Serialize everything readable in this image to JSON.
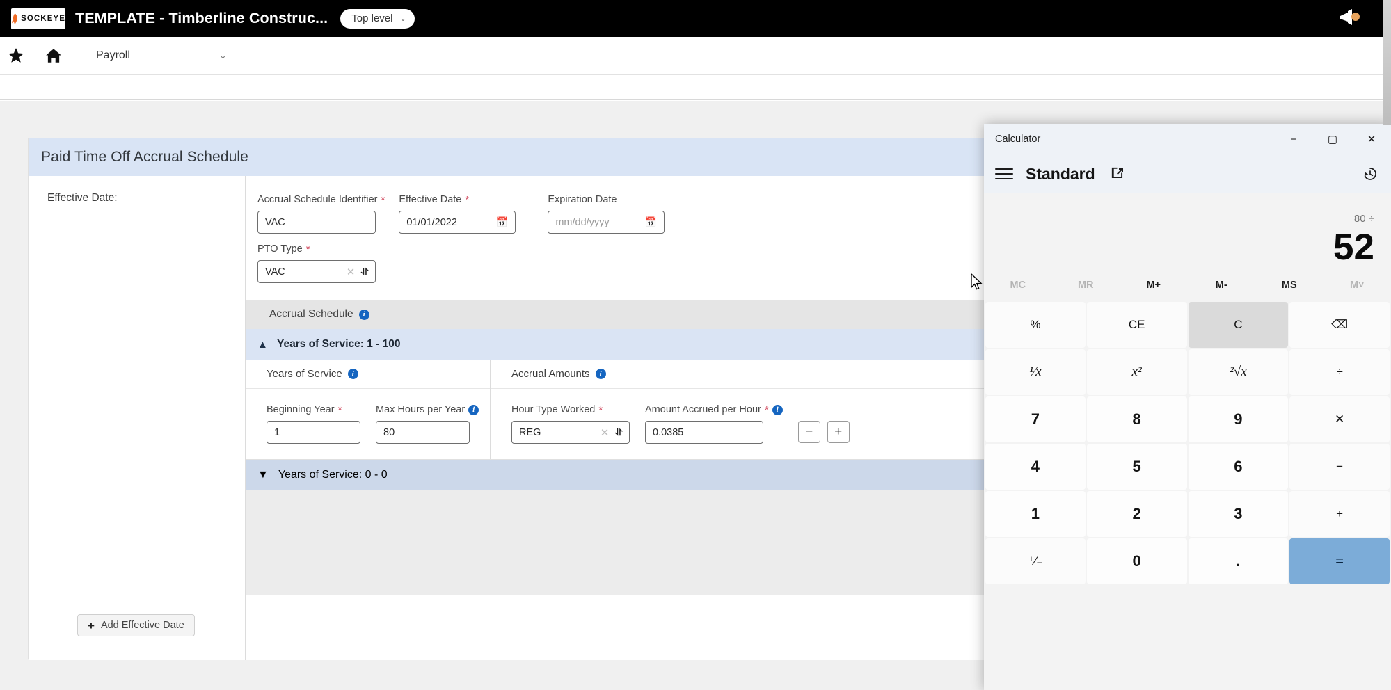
{
  "topbar": {
    "logo_text": "SOCKEYE",
    "app_title": "TEMPLATE - Timberline Construc...",
    "scope_label": "Top level",
    "scope_caret": "⌄",
    "megaphone_icon": "megaphone-icon"
  },
  "navbar": {
    "star_icon": "star-icon",
    "home_icon": "home-icon",
    "module_label": "Payroll",
    "module_caret": "⌄"
  },
  "card": {
    "title": "Paid Time Off Accrual Schedule",
    "left_pane": {
      "effective_date_label": "Effective Date:",
      "add_button_label": "Add Effective Date",
      "add_button_icon": "plus-icon"
    },
    "fields": {
      "accrual_schedule_identifier": {
        "label": "Accrual Schedule Identifier",
        "required": "*",
        "value": "VAC"
      },
      "effective_date": {
        "label": "Effective Date",
        "required": "*",
        "value": "01/01/2022",
        "icon": "calendar-icon"
      },
      "expiration_date": {
        "label": "Expiration Date",
        "required": "",
        "placeholder": "mm/dd/yyyy",
        "icon": "calendar-icon"
      },
      "pto_type": {
        "label": "PTO Type",
        "required": "*",
        "value": "VAC",
        "clear_icon": "clear-x-icon",
        "caret_icon": "chevron-down-icon"
      }
    },
    "accrual_schedule_band": {
      "label": "Accrual Schedule",
      "info_icon": "info-icon"
    },
    "section_1": {
      "collapse_icon": "chevron-up-icon",
      "title": "Years of Service: 1 - 100",
      "left_col_header": "Years of Service",
      "left_col_info": "info-icon",
      "right_col_header": "Accrual Amounts",
      "right_col_info": "info-icon",
      "beginning_year": {
        "label": "Beginning Year",
        "required": "*",
        "value": "1"
      },
      "max_hours_per_year": {
        "label": "Max Hours per Year",
        "required": "",
        "info_icon": "info-icon",
        "value": "80"
      },
      "hour_type_worked": {
        "label": "Hour Type Worked",
        "required": "*",
        "value": "REG",
        "clear_icon": "clear-x-icon",
        "caret_icon": "chevron-down-icon"
      },
      "amount_accrued_per_hour": {
        "label": "Amount Accrued per Hour",
        "required": "*",
        "info_icon": "info-icon",
        "value": "0.0385"
      },
      "remove_row_label": "−",
      "add_row_label": "+"
    },
    "section_2": {
      "expand_icon": "chevron-down-icon",
      "title": "Years of Service: 0 - 0"
    }
  },
  "calculator": {
    "window_title": "Calculator",
    "minimize_label": "−",
    "maximize_label": "▢",
    "close_label": "✕",
    "menu_icon": "hamburger-menu-icon",
    "mode_label": "Standard",
    "popout_icon": "keep-on-top-icon",
    "history_icon": "history-icon",
    "expression": "80 ÷",
    "result": "52",
    "memory_buttons": [
      {
        "label": "MC",
        "enabled": false
      },
      {
        "label": "MR",
        "enabled": false
      },
      {
        "label": "M+",
        "enabled": true
      },
      {
        "label": "M-",
        "enabled": true
      },
      {
        "label": "MS",
        "enabled": true
      },
      {
        "label": "M˅",
        "enabled": false
      }
    ],
    "keys": [
      {
        "label": "%",
        "type": "fn",
        "hover": false
      },
      {
        "label": "CE",
        "type": "fn",
        "hover": false
      },
      {
        "label": "C",
        "type": "fn",
        "hover": true
      },
      {
        "label": "⌫",
        "type": "fn",
        "hover": false
      },
      {
        "label": "¹⁄x",
        "type": "ital",
        "hover": false
      },
      {
        "label": "x²",
        "type": "ital",
        "hover": false
      },
      {
        "label": "²√x",
        "type": "ital",
        "hover": false
      },
      {
        "label": "÷",
        "type": "fn",
        "hover": false
      },
      {
        "label": "7",
        "type": "num",
        "hover": false
      },
      {
        "label": "8",
        "type": "num",
        "hover": false
      },
      {
        "label": "9",
        "type": "num",
        "hover": false
      },
      {
        "label": "✕",
        "type": "fn",
        "hover": false
      },
      {
        "label": "4",
        "type": "num",
        "hover": false
      },
      {
        "label": "5",
        "type": "num",
        "hover": false
      },
      {
        "label": "6",
        "type": "num",
        "hover": false
      },
      {
        "label": "−",
        "type": "fn",
        "hover": false
      },
      {
        "label": "1",
        "type": "num",
        "hover": false
      },
      {
        "label": "2",
        "type": "num",
        "hover": false
      },
      {
        "label": "3",
        "type": "num",
        "hover": false
      },
      {
        "label": "+",
        "type": "fn",
        "hover": false
      },
      {
        "label": "⁺⁄₋",
        "type": "fn",
        "hover": false
      },
      {
        "label": "0",
        "type": "num",
        "hover": false
      },
      {
        "label": ".",
        "type": "num",
        "hover": false
      },
      {
        "label": "=",
        "type": "equals",
        "hover": false
      }
    ]
  },
  "colors": {
    "accent_blue": "#1565c0",
    "card_header": "#d9e4f5",
    "band_blue": "#dae4f4",
    "band_blue_dark": "#ccd8ea",
    "required_red": "#d0475c",
    "equals_blue": "#7cacd8"
  }
}
